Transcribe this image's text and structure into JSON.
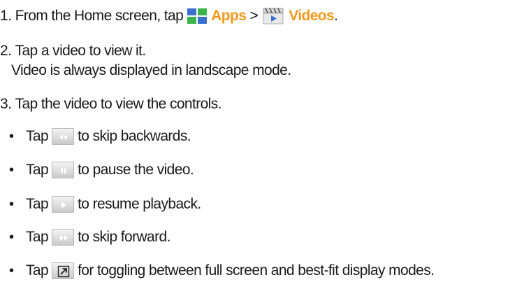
{
  "steps": [
    {
      "number": "1.",
      "text_before": "From the Home screen, tap",
      "apps_label": "Apps",
      "separator": ">",
      "videos_label": "Videos",
      "end": "."
    },
    {
      "number": "2.",
      "text": "Tap a video to view it.",
      "subtext": "Video is always displayed in landscape mode."
    },
    {
      "number": "3.",
      "text": "Tap the video to view the controls."
    }
  ],
  "bullet_char": "•",
  "bullets": [
    {
      "tap": "Tap",
      "icon": "rewind-icon",
      "text": "to skip backwards."
    },
    {
      "tap": "Tap",
      "icon": "pause-icon",
      "text": "to pause the video."
    },
    {
      "tap": "Tap",
      "icon": "play-icon",
      "text": "to resume playback."
    },
    {
      "tap": "Tap",
      "icon": "fast-forward-icon",
      "text": "to skip forward."
    },
    {
      "tap": "Tap",
      "icon": "fullscreen-toggle-icon",
      "text": "for toggling between full screen and best-fit display modes."
    }
  ],
  "colors": {
    "highlight": "#f39a1e",
    "text": "#1a1a1a",
    "apps_tiles": [
      "#3a6fd0",
      "#3bb54a",
      "#3bb54a",
      "#3a6fd0"
    ],
    "control_glyph": "#ffffff"
  }
}
